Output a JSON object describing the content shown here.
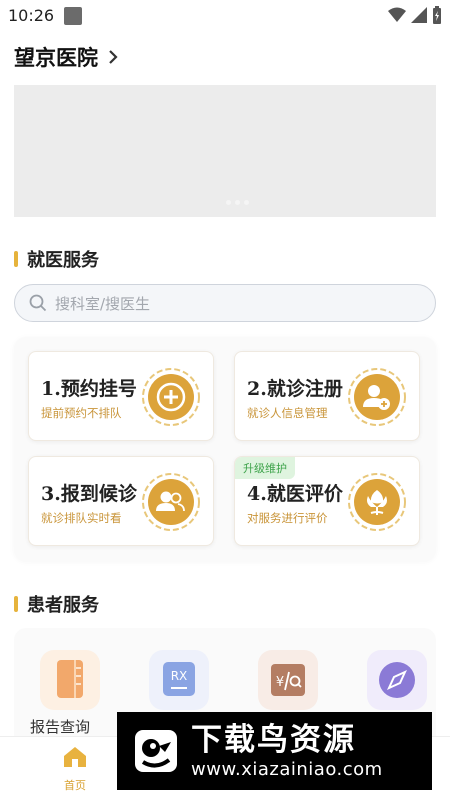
{
  "status_bar": {
    "time": "10:26"
  },
  "header": {
    "hospital_name": "望京医院"
  },
  "sections": {
    "medical": "就医服务",
    "patient": "患者服务"
  },
  "search": {
    "placeholder": "搜科室/搜医生"
  },
  "services": [
    {
      "title": "1.预约挂号",
      "subtitle": "提前预约不排队",
      "icon": "plus-icon"
    },
    {
      "title": "2.就诊注册",
      "subtitle": "就诊人信息管理",
      "icon": "user-add-icon"
    },
    {
      "title": "3.报到候诊",
      "subtitle": "就诊排队实时看",
      "icon": "queue-icon"
    },
    {
      "title": "4.就医评价",
      "subtitle": "对服务进行评价",
      "icon": "flower-icon",
      "badge": "升级维护"
    }
  ],
  "patient_services": [
    {
      "label": "报告查询",
      "icon": "report-icon",
      "color": "#f2a86b"
    },
    {
      "label": "",
      "icon": "prescription-icon",
      "color": "#8aa4e3"
    },
    {
      "label": "",
      "icon": "payment-query-icon",
      "color": "#b47d63"
    },
    {
      "label": "",
      "icon": "compass-icon",
      "color": "#8b7ad6"
    }
  ],
  "tabbar": {
    "home": "首页"
  },
  "watermark": {
    "title": "下载鸟资源",
    "url": "www.xiazainiao.com"
  },
  "colors": {
    "accent": "#e6b33c",
    "gold": "#c9953a"
  }
}
